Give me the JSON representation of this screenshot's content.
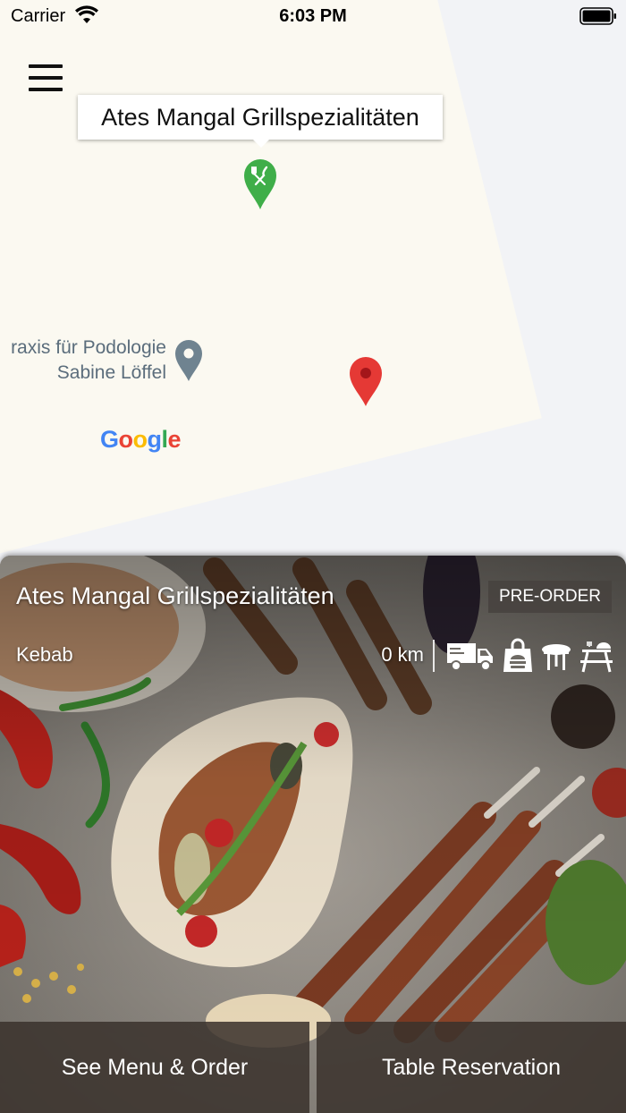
{
  "status_bar": {
    "carrier": "Carrier",
    "time": "6:03 PM"
  },
  "map": {
    "callout_title": "Ates Mangal Grillspezialitäten",
    "poi_label_line1": "raxis für Podologie",
    "poi_label_line2": "Sabine Löffel",
    "google_logo": {
      "letters": [
        "G",
        "o",
        "o",
        "g",
        "l",
        "e"
      ],
      "colors": [
        "#4285F4",
        "#EA4335",
        "#FBBC05",
        "#4285F4",
        "#34A853",
        "#EA4335"
      ]
    }
  },
  "card": {
    "title": "Ates Mangal Grillspezialitäten",
    "badge": "PRE-ORDER",
    "category": "Kebab",
    "distance": "0 km",
    "services": [
      "delivery-icon",
      "takeaway-icon",
      "dine-in-icon",
      "picnic-icon"
    ]
  },
  "actions": {
    "menu_order": "See Menu & Order",
    "table_reservation": "Table Reservation"
  },
  "colors": {
    "restaurant_marker": "#3fae49",
    "location_marker": "#e53935",
    "poi_marker": "#6f8390",
    "action_bg": "#3a322c"
  }
}
